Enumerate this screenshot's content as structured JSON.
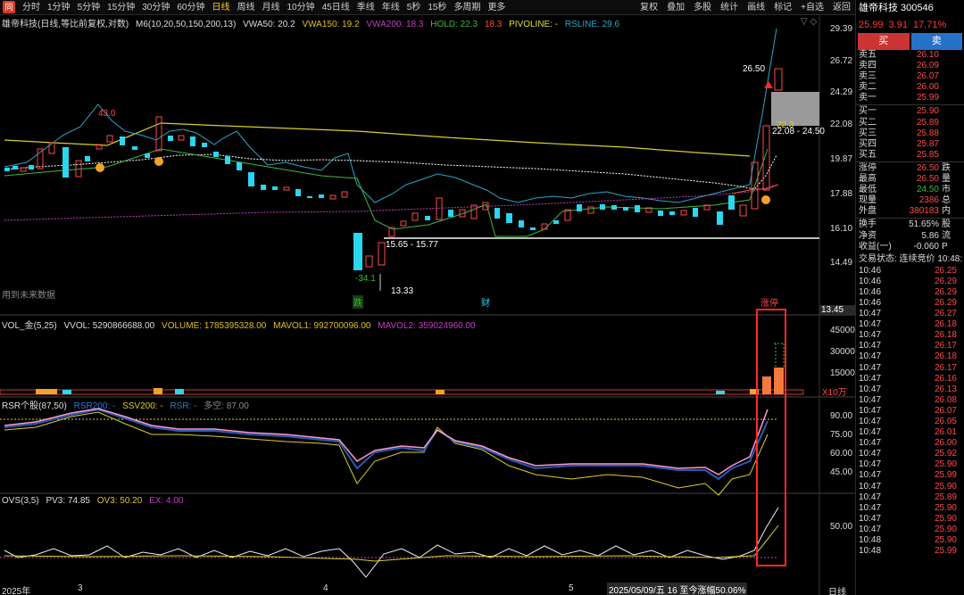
{
  "toolbar": {
    "logo": "同",
    "periods": [
      "分时",
      "1分钟",
      "5分钟",
      "15分钟",
      "30分钟",
      "60分钟",
      "日线",
      "周线",
      "月线",
      "10分钟",
      "45日线",
      "季线",
      "年线",
      "5秒",
      "15秒",
      "多周期",
      "更多"
    ],
    "active_period": "日线",
    "tools": [
      "复权",
      "叠加",
      "多股",
      "统计",
      "画线",
      "标记",
      "+自选",
      "返回"
    ]
  },
  "main_chart": {
    "header": {
      "name": "雄帝科技(日线,等比前复权,对数)",
      "ma": "M6(10,20,50,150,200,13)",
      "vwa50": "VWA50: 20.2",
      "vwa150": "VWA150: 19.2",
      "vwa200": "VWA200: 18.3",
      "hold": "HOLD: 22.3",
      "hold_extra": "18.3",
      "pivoline": "PIVOLINE: -",
      "rsline": "RSLINE: 29.6"
    },
    "y_ticks": [
      "29.39",
      "26.72",
      "24.29",
      "22.08",
      "19.87",
      "17.88",
      "16.10",
      "14.49"
    ],
    "annotations": {
      "high_top": "43.0",
      "label_2650": "26.50",
      "label_223": "22.3",
      "label_range_high": "22.08 - 24.50",
      "label_range_low": "15.65 - 15.77",
      "label_low": "13.33",
      "label_neg": "-34.1",
      "label_future": "用到未来数据",
      "marker_die": "跌",
      "marker_cai": "财",
      "marker_zhangting": "涨停",
      "last_price_box": "13.45"
    }
  },
  "vol_panel": {
    "header": {
      "name": "VOL_金(5,25)",
      "vvol": "VVOL: 5290866688.00",
      "volume": "VOLUME: 1785395328.00",
      "mavol1": "MAVOL1: 992700096.00",
      "mavol2": "MAVOL2: 359024960.00"
    },
    "y_ticks": [
      "45000",
      "30000",
      "15000"
    ],
    "unit": "X10万"
  },
  "rsr_panel": {
    "header": {
      "name": "RSR个股(87,50)",
      "rsr200": "RSR200: -",
      "ssv200": "SSV200: -",
      "rsr": "RSR: -",
      "duokong": "多空: 87.00"
    },
    "y_ticks": [
      "90.00",
      "75.00",
      "60.00",
      "45.00"
    ]
  },
  "ovs_panel": {
    "header": {
      "name": "OVS(3,5)",
      "pv3": "PV3: 74.85",
      "ov3": "OV3: 50.20",
      "ex": "EX: 4.00"
    },
    "y_ticks": [
      "50.00"
    ]
  },
  "x_axis": {
    "labels": [
      "2025年",
      "3",
      "4",
      "5"
    ],
    "cursor_date": "2025/05/09/五 16 至今涨幅50.06%",
    "period": "日线"
  },
  "quote_panel": {
    "title": "雄帝科技 300546",
    "price": "25.99",
    "change": "3.91",
    "pct": "17.71%",
    "buy_label": "买",
    "sell_label": "卖",
    "asks": [
      {
        "label": "卖五",
        "price": "26.10",
        "size": ""
      },
      {
        "label": "卖四",
        "price": "26.09",
        "size": ""
      },
      {
        "label": "卖三",
        "price": "26.07",
        "size": ""
      },
      {
        "label": "卖二",
        "price": "26.00",
        "size": ""
      },
      {
        "label": "卖一",
        "price": "25.99",
        "size": ""
      }
    ],
    "bids": [
      {
        "label": "买一",
        "price": "25.90",
        "size": ""
      },
      {
        "label": "买二",
        "price": "25.89",
        "size": ""
      },
      {
        "label": "买三",
        "price": "25.88",
        "size": ""
      },
      {
        "label": "买四",
        "price": "25.87",
        "size": ""
      },
      {
        "label": "买五",
        "price": "25.85",
        "size": ""
      }
    ],
    "stats1": [
      {
        "label": "涨停",
        "value": "26.50",
        "side": "跌"
      },
      {
        "label": "最高",
        "value": "26.50",
        "side": "量"
      },
      {
        "label": "最低",
        "value": "24.50",
        "side": "市"
      },
      {
        "label": "现量",
        "value": "2386",
        "side": "总"
      },
      {
        "label": "外盘",
        "value": "380183",
        "side": "内"
      }
    ],
    "stats2": [
      {
        "label": "换手",
        "value": "51.65%",
        "side": "股"
      },
      {
        "label": "净资",
        "value": "5.86",
        "side": "流"
      },
      {
        "label": "收益(一)",
        "value": "-0.060",
        "side": "P"
      }
    ],
    "status": "交易状态: 连续竞价 10:48:",
    "ticks": [
      {
        "t": "10:46",
        "p": "26.25"
      },
      {
        "t": "10:46",
        "p": "26.29"
      },
      {
        "t": "10:46",
        "p": "26.29"
      },
      {
        "t": "10:46",
        "p": "26.29"
      },
      {
        "t": "10:47",
        "p": "26.27"
      },
      {
        "t": "10:47",
        "p": "26.18"
      },
      {
        "t": "10:47",
        "p": "26.18"
      },
      {
        "t": "10:47",
        "p": "26.17"
      },
      {
        "t": "10:47",
        "p": "26.18"
      },
      {
        "t": "10:47",
        "p": "26.17"
      },
      {
        "t": "10:47",
        "p": "26.16"
      },
      {
        "t": "10:47",
        "p": "26.13"
      },
      {
        "t": "10:47",
        "p": "26.08"
      },
      {
        "t": "10:47",
        "p": "26.07"
      },
      {
        "t": "10:47",
        "p": "26.05"
      },
      {
        "t": "10:47",
        "p": "26.01"
      },
      {
        "t": "10:47",
        "p": "26.00"
      },
      {
        "t": "10:47",
        "p": "25.92"
      },
      {
        "t": "10:47",
        "p": "25.90"
      },
      {
        "t": "10:47",
        "p": "25.99"
      },
      {
        "t": "10:47",
        "p": "25.90"
      },
      {
        "t": "10:47",
        "p": "25.89"
      },
      {
        "t": "10:47",
        "p": "25.90"
      },
      {
        "t": "10:47",
        "p": "25.90"
      },
      {
        "t": "10:47",
        "p": "25.90"
      },
      {
        "t": "10:48",
        "p": "25.90"
      },
      {
        "t": "10:48",
        "p": "25.99"
      }
    ]
  }
}
